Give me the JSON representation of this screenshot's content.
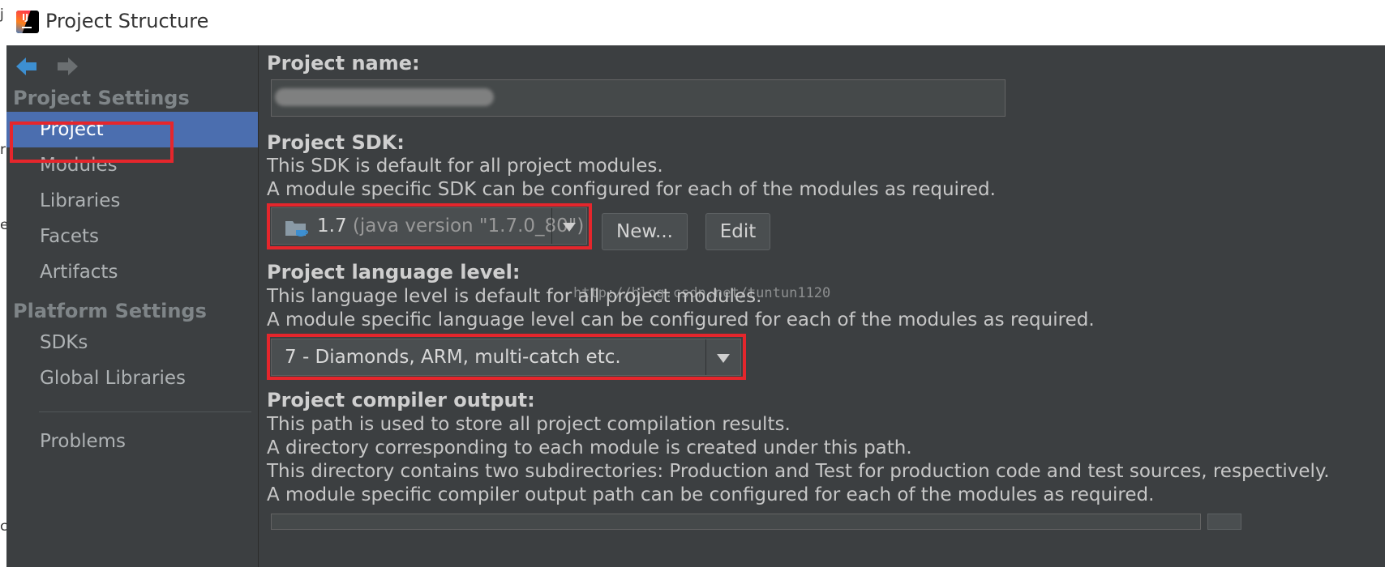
{
  "window": {
    "title": "Project Structure"
  },
  "left_strip": {
    "glyphs": [
      "j",
      "r",
      "e",
      "c"
    ]
  },
  "sidebar": {
    "headers": {
      "project_settings": "Project Settings",
      "platform_settings": "Platform Settings"
    },
    "items": [
      {
        "label": "Project",
        "selected": true
      },
      {
        "label": "Modules"
      },
      {
        "label": "Libraries"
      },
      {
        "label": "Facets"
      },
      {
        "label": "Artifacts"
      },
      {
        "label": "SDKs"
      },
      {
        "label": "Global Libraries"
      },
      {
        "label": "Problems"
      }
    ]
  },
  "main": {
    "project_name": {
      "label": "Project name:",
      "value": ""
    },
    "project_sdk": {
      "label": "Project SDK:",
      "desc": [
        "This SDK is default for all project modules.",
        "A module specific SDK can be configured for each of the modules as required."
      ],
      "selected_version": "1.7",
      "selected_detail": "(java version \"1.7.0_80\")",
      "new_button": "New...",
      "edit_button": "Edit"
    },
    "watermark": "http://blog.csdn.net/tuntun1120",
    "language_level": {
      "label": "Project language level:",
      "desc": [
        "This language level is default for all project modules.",
        "A module specific language level can be configured for each of the modules as required."
      ],
      "selected": "7 - Diamonds, ARM, multi-catch etc."
    },
    "compiler_output": {
      "label": "Project compiler output:",
      "desc": [
        "This path is used to store all project compilation results.",
        "A directory corresponding to each module is created under this path.",
        "This directory contains two subdirectories: Production and Test for production code and test sources, respectively.",
        "A module specific compiler output path can be configured for each of the modules as required."
      ]
    }
  },
  "colors": {
    "background": "#3c3f41",
    "selection": "#4b6eaf",
    "highlight_annotation": "#e5262c",
    "nav_back_arrow": "#3d8fd1",
    "nav_forward_arrow": "#6b6f71"
  }
}
